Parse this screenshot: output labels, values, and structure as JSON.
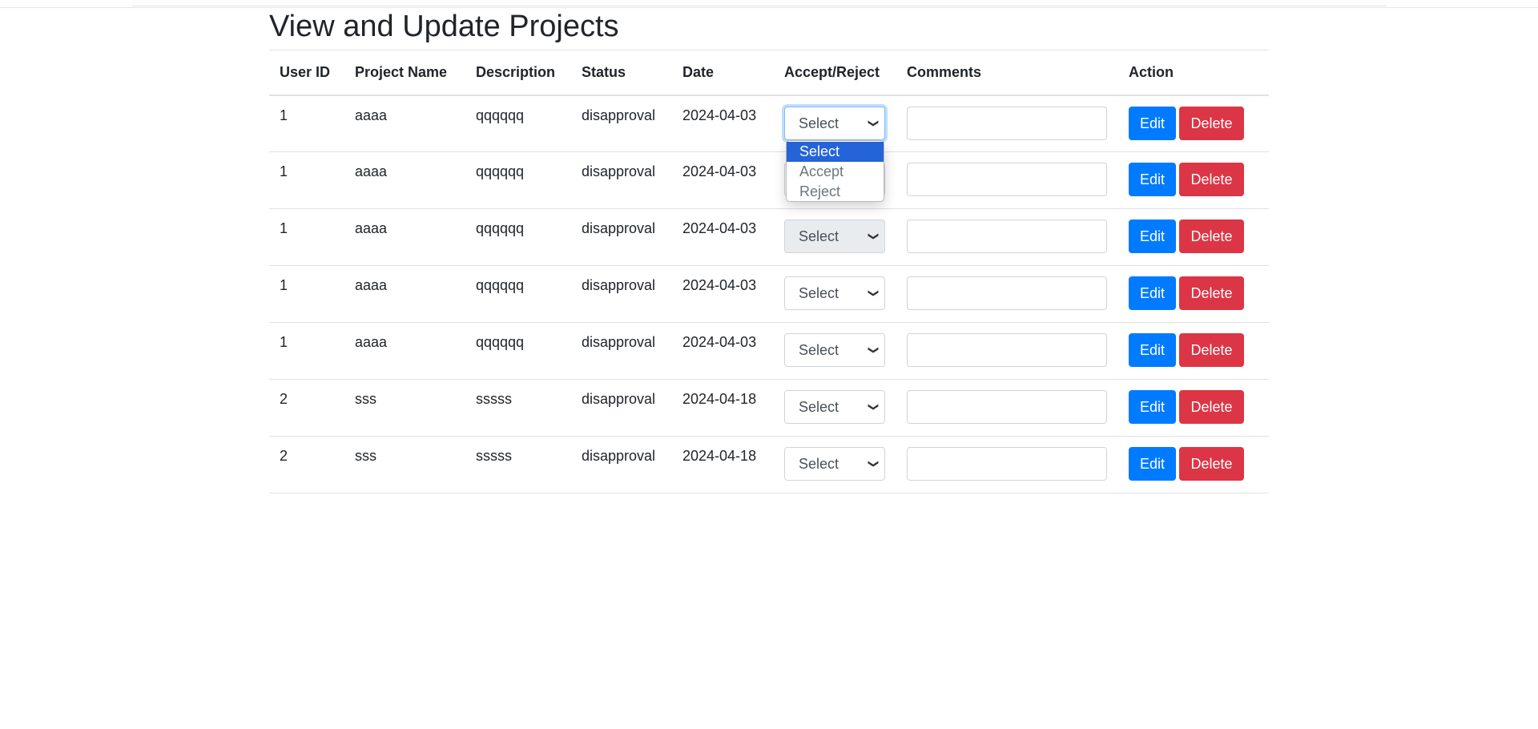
{
  "page": {
    "title": "View and Update Projects"
  },
  "table": {
    "headers": [
      "User ID",
      "Project Name",
      "Description",
      "Status",
      "Date",
      "Accept/Reject",
      "Comments",
      "Action"
    ],
    "rows": [
      {
        "user_id": "1",
        "project_name": "aaaa",
        "description": "qqqqqq",
        "status": "disapproval",
        "date": "2024-04-03",
        "decision": "Select",
        "comment": ""
      },
      {
        "user_id": "1",
        "project_name": "aaaa",
        "description": "qqqqqq",
        "status": "disapproval",
        "date": "2024-04-03",
        "decision": "Select",
        "comment": ""
      },
      {
        "user_id": "1",
        "project_name": "aaaa",
        "description": "qqqqqq",
        "status": "disapproval",
        "date": "2024-04-03",
        "decision": "Select",
        "comment": ""
      },
      {
        "user_id": "1",
        "project_name": "aaaa",
        "description": "qqqqqq",
        "status": "disapproval",
        "date": "2024-04-03",
        "decision": "Select",
        "comment": ""
      },
      {
        "user_id": "1",
        "project_name": "aaaa",
        "description": "qqqqqq",
        "status": "disapproval",
        "date": "2024-04-03",
        "decision": "Select",
        "comment": ""
      },
      {
        "user_id": "2",
        "project_name": "sss",
        "description": "sssss",
        "status": "disapproval",
        "date": "2024-04-18",
        "decision": "Select",
        "comment": ""
      },
      {
        "user_id": "2",
        "project_name": "sss",
        "description": "sssss",
        "status": "disapproval",
        "date": "2024-04-18",
        "decision": "Select",
        "comment": ""
      }
    ],
    "edit_label": "Edit",
    "delete_label": "Delete"
  },
  "dropdown": {
    "options": [
      "Select",
      "Accept",
      "Reject"
    ],
    "highlighted": "Select"
  },
  "colors": {
    "edit_button": "#007bff",
    "delete_button": "#dc3545",
    "dropdown_highlight": "#2563d8"
  }
}
